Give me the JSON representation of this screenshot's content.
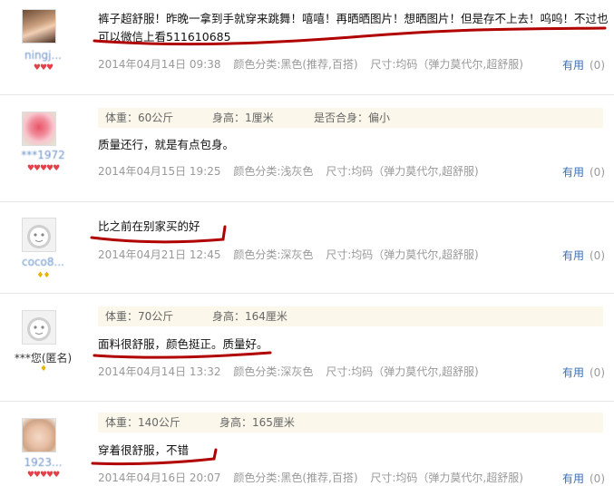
{
  "reviews": [
    {
      "username": "ningj...",
      "level": "♥♥♥",
      "content": "裤子超舒服！昨晚一拿到手就穿来跳舞！嘻嘻！再晒晒图片！想晒图片！但是存不上去！呜呜！不过也可以微信上看511610685",
      "date": "2014年04月14日 09:38",
      "color": "颜色分类:黑色(推荐,百搭)",
      "size": "尺寸:均码（弹力莫代尔,超舒服)",
      "helpful_label": "有用",
      "helpful_count": "(0)"
    },
    {
      "username": "***1972",
      "level": "♥♥♥♥♥",
      "weight": "体重：60公斤",
      "height": "身高：1厘米",
      "fit": "是否合身：偏小",
      "content": "质量还行，就是有点包身。",
      "date": "2014年04月15日 19:25",
      "color": "颜色分类:浅灰色",
      "size": "尺寸:均码（弹力莫代尔,超舒服)",
      "helpful_label": "有用",
      "helpful_count": "(0)"
    },
    {
      "username": "coco8...",
      "level": "♦♦",
      "content": "比之前在别家买的好",
      "date": "2014年04月21日 12:45",
      "color": "颜色分类:深灰色",
      "size": "尺寸:均码（弹力莫代尔,超舒服)",
      "helpful_label": "有用",
      "helpful_count": "(0)"
    },
    {
      "username": "***您(匿名)",
      "level": "♦",
      "weight": "体重：70公斤",
      "height": "身高：164厘米",
      "content": "面料很舒服，颜色挺正。质量好。",
      "date": "2014年04月14日 13:32",
      "color": "颜色分类:深灰色",
      "size": "尺寸:均码（弹力莫代尔,超舒服)",
      "helpful_label": "有用",
      "helpful_count": "(0)"
    },
    {
      "username": "1923...",
      "level": "♥♥♥♥♥",
      "weight": "体重：140公斤",
      "height": "身高：165厘米",
      "content": "穿着很舒服，不错",
      "date": "2014年04月16日 20:07",
      "color": "颜色分类:黑色(推荐,百搭)",
      "size": "尺寸:均码（弹力莫代尔,超舒服)",
      "helpful_label": "有用",
      "helpful_count": "(0)"
    }
  ],
  "colors": {
    "link": "#3b6fb6",
    "annotation": "#b00000",
    "attr_bg": "#fbf7ea"
  }
}
